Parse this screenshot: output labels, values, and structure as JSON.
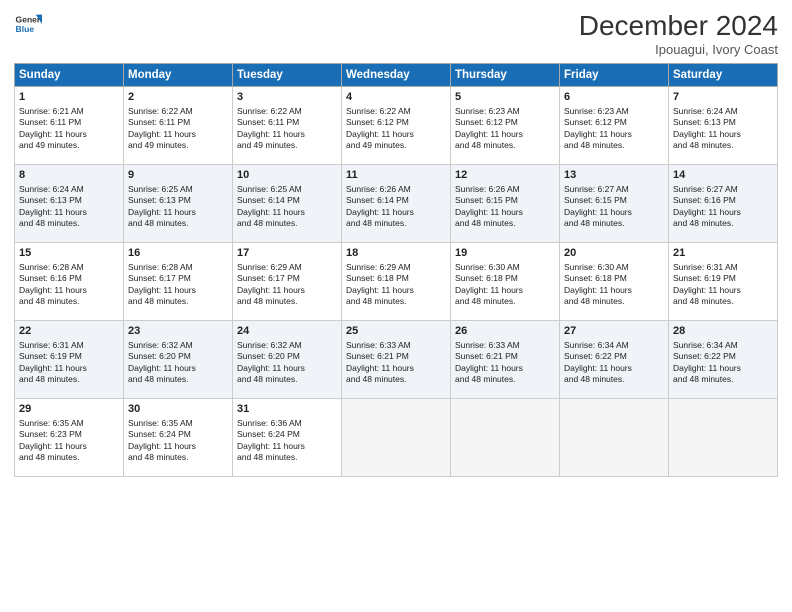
{
  "header": {
    "logo_line1": "General",
    "logo_line2": "Blue",
    "month_title": "December 2024",
    "location": "Ipouagui, Ivory Coast"
  },
  "days_of_week": [
    "Sunday",
    "Monday",
    "Tuesday",
    "Wednesday",
    "Thursday",
    "Friday",
    "Saturday"
  ],
  "weeks": [
    [
      {
        "day": "1",
        "lines": [
          "Sunrise: 6:21 AM",
          "Sunset: 6:11 PM",
          "Daylight: 11 hours",
          "and 49 minutes."
        ]
      },
      {
        "day": "2",
        "lines": [
          "Sunrise: 6:22 AM",
          "Sunset: 6:11 PM",
          "Daylight: 11 hours",
          "and 49 minutes."
        ]
      },
      {
        "day": "3",
        "lines": [
          "Sunrise: 6:22 AM",
          "Sunset: 6:11 PM",
          "Daylight: 11 hours",
          "and 49 minutes."
        ]
      },
      {
        "day": "4",
        "lines": [
          "Sunrise: 6:22 AM",
          "Sunset: 6:12 PM",
          "Daylight: 11 hours",
          "and 49 minutes."
        ]
      },
      {
        "day": "5",
        "lines": [
          "Sunrise: 6:23 AM",
          "Sunset: 6:12 PM",
          "Daylight: 11 hours",
          "and 48 minutes."
        ]
      },
      {
        "day": "6",
        "lines": [
          "Sunrise: 6:23 AM",
          "Sunset: 6:12 PM",
          "Daylight: 11 hours",
          "and 48 minutes."
        ]
      },
      {
        "day": "7",
        "lines": [
          "Sunrise: 6:24 AM",
          "Sunset: 6:13 PM",
          "Daylight: 11 hours",
          "and 48 minutes."
        ]
      }
    ],
    [
      {
        "day": "8",
        "lines": [
          "Sunrise: 6:24 AM",
          "Sunset: 6:13 PM",
          "Daylight: 11 hours",
          "and 48 minutes."
        ]
      },
      {
        "day": "9",
        "lines": [
          "Sunrise: 6:25 AM",
          "Sunset: 6:13 PM",
          "Daylight: 11 hours",
          "and 48 minutes."
        ]
      },
      {
        "day": "10",
        "lines": [
          "Sunrise: 6:25 AM",
          "Sunset: 6:14 PM",
          "Daylight: 11 hours",
          "and 48 minutes."
        ]
      },
      {
        "day": "11",
        "lines": [
          "Sunrise: 6:26 AM",
          "Sunset: 6:14 PM",
          "Daylight: 11 hours",
          "and 48 minutes."
        ]
      },
      {
        "day": "12",
        "lines": [
          "Sunrise: 6:26 AM",
          "Sunset: 6:15 PM",
          "Daylight: 11 hours",
          "and 48 minutes."
        ]
      },
      {
        "day": "13",
        "lines": [
          "Sunrise: 6:27 AM",
          "Sunset: 6:15 PM",
          "Daylight: 11 hours",
          "and 48 minutes."
        ]
      },
      {
        "day": "14",
        "lines": [
          "Sunrise: 6:27 AM",
          "Sunset: 6:16 PM",
          "Daylight: 11 hours",
          "and 48 minutes."
        ]
      }
    ],
    [
      {
        "day": "15",
        "lines": [
          "Sunrise: 6:28 AM",
          "Sunset: 6:16 PM",
          "Daylight: 11 hours",
          "and 48 minutes."
        ]
      },
      {
        "day": "16",
        "lines": [
          "Sunrise: 6:28 AM",
          "Sunset: 6:17 PM",
          "Daylight: 11 hours",
          "and 48 minutes."
        ]
      },
      {
        "day": "17",
        "lines": [
          "Sunrise: 6:29 AM",
          "Sunset: 6:17 PM",
          "Daylight: 11 hours",
          "and 48 minutes."
        ]
      },
      {
        "day": "18",
        "lines": [
          "Sunrise: 6:29 AM",
          "Sunset: 6:18 PM",
          "Daylight: 11 hours",
          "and 48 minutes."
        ]
      },
      {
        "day": "19",
        "lines": [
          "Sunrise: 6:30 AM",
          "Sunset: 6:18 PM",
          "Daylight: 11 hours",
          "and 48 minutes."
        ]
      },
      {
        "day": "20",
        "lines": [
          "Sunrise: 6:30 AM",
          "Sunset: 6:18 PM",
          "Daylight: 11 hours",
          "and 48 minutes."
        ]
      },
      {
        "day": "21",
        "lines": [
          "Sunrise: 6:31 AM",
          "Sunset: 6:19 PM",
          "Daylight: 11 hours",
          "and 48 minutes."
        ]
      }
    ],
    [
      {
        "day": "22",
        "lines": [
          "Sunrise: 6:31 AM",
          "Sunset: 6:19 PM",
          "Daylight: 11 hours",
          "and 48 minutes."
        ]
      },
      {
        "day": "23",
        "lines": [
          "Sunrise: 6:32 AM",
          "Sunset: 6:20 PM",
          "Daylight: 11 hours",
          "and 48 minutes."
        ]
      },
      {
        "day": "24",
        "lines": [
          "Sunrise: 6:32 AM",
          "Sunset: 6:20 PM",
          "Daylight: 11 hours",
          "and 48 minutes."
        ]
      },
      {
        "day": "25",
        "lines": [
          "Sunrise: 6:33 AM",
          "Sunset: 6:21 PM",
          "Daylight: 11 hours",
          "and 48 minutes."
        ]
      },
      {
        "day": "26",
        "lines": [
          "Sunrise: 6:33 AM",
          "Sunset: 6:21 PM",
          "Daylight: 11 hours",
          "and 48 minutes."
        ]
      },
      {
        "day": "27",
        "lines": [
          "Sunrise: 6:34 AM",
          "Sunset: 6:22 PM",
          "Daylight: 11 hours",
          "and 48 minutes."
        ]
      },
      {
        "day": "28",
        "lines": [
          "Sunrise: 6:34 AM",
          "Sunset: 6:22 PM",
          "Daylight: 11 hours",
          "and 48 minutes."
        ]
      }
    ],
    [
      {
        "day": "29",
        "lines": [
          "Sunrise: 6:35 AM",
          "Sunset: 6:23 PM",
          "Daylight: 11 hours",
          "and 48 minutes."
        ]
      },
      {
        "day": "30",
        "lines": [
          "Sunrise: 6:35 AM",
          "Sunset: 6:24 PM",
          "Daylight: 11 hours",
          "and 48 minutes."
        ]
      },
      {
        "day": "31",
        "lines": [
          "Sunrise: 6:36 AM",
          "Sunset: 6:24 PM",
          "Daylight: 11 hours",
          "and 48 minutes."
        ]
      },
      null,
      null,
      null,
      null
    ]
  ]
}
